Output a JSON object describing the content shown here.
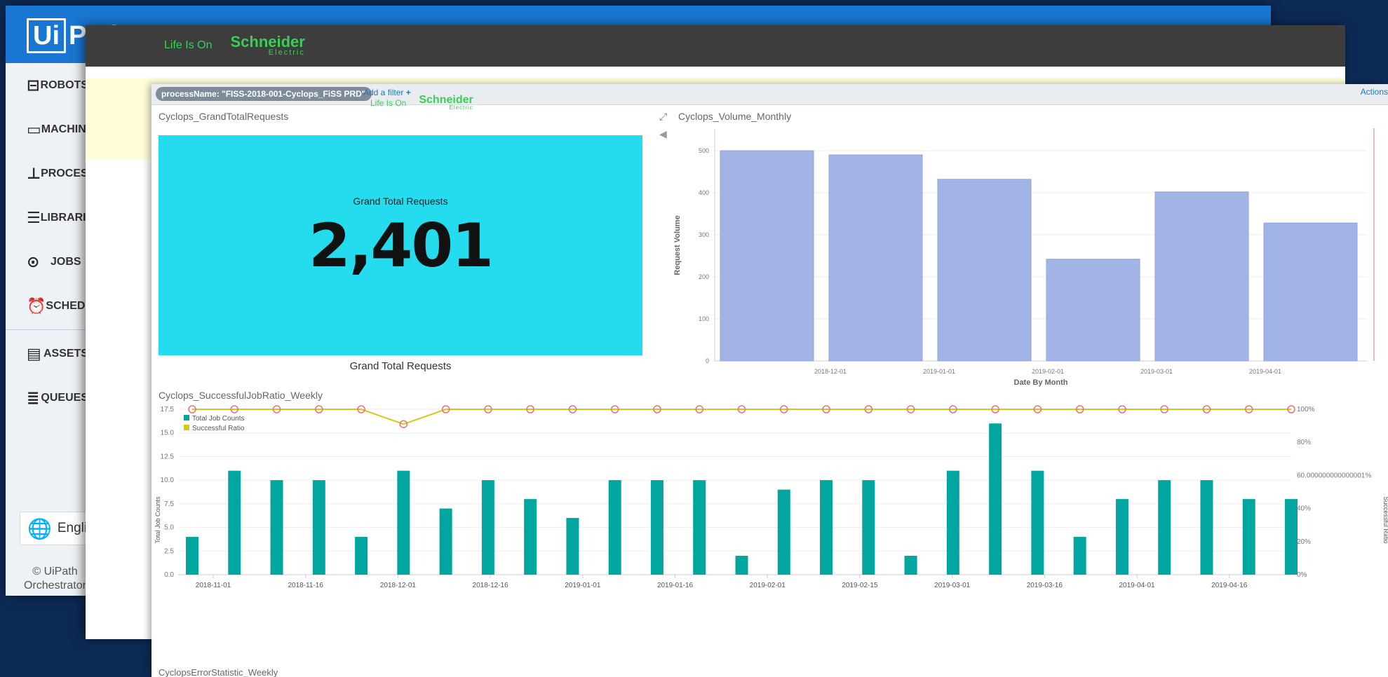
{
  "orchestrator": {
    "logo_box": "Ui",
    "logo_rest": "Path",
    "nav": [
      {
        "label": "ROBOTS",
        "icon": "robot-icon"
      },
      {
        "label": "MACHINES",
        "icon": "monitor-icon"
      },
      {
        "label": "PROCESSES",
        "icon": "sitemap-icon"
      },
      {
        "label": "LIBRARIES",
        "icon": "library-icon"
      },
      {
        "label": "JOBS",
        "icon": "play-circle-icon"
      },
      {
        "label": "SCHEDULES",
        "icon": "alarm-clock-icon"
      },
      {
        "label": "ASSETS",
        "icon": "assets-icon"
      },
      {
        "label": "QUEUES",
        "icon": "queue-icon"
      }
    ],
    "language": "English",
    "copyright_line1": "© UiPath",
    "copyright_line2": "Orchestrator"
  },
  "portal": {
    "tagline": "Life Is On",
    "brand": "Schneider",
    "brand_sub": "Electric"
  },
  "kibana": {
    "filter_pill": "processName: \"FISS-2018-001-Cyclops_FiSS PRD\"",
    "add_filter": "Add a filter",
    "actions": "Actions",
    "tagline": "Life Is On",
    "brand": "Schneider",
    "brand_sub": "Electric",
    "panels": {
      "grand_total": {
        "title": "Cyclops_GrandTotalRequests",
        "label": "Grand Total Requests",
        "value": "2,401",
        "caption": "Grand Total Requests",
        "color": "#24dcee"
      },
      "volume_monthly_title": "Cyclops_Volume_Monthly",
      "job_ratio_title": "Cyclops_SuccessfulJobRatio_Weekly",
      "error_stat_title": "CyclopsErrorStatistic_Weekly"
    }
  },
  "chart_data": [
    {
      "type": "bar",
      "title": "Cyclops_Volume_Monthly",
      "xlabel": "Date By Month",
      "ylabel": "Request Volume",
      "x_tick_labels": [
        "2018-12-01",
        "2019-01-01",
        "2019-02-01",
        "2019-03-01",
        "2019-04-01"
      ],
      "values": [
        500,
        490,
        432,
        242,
        402,
        328
      ],
      "yticks": [
        0,
        100,
        200,
        300,
        400,
        500
      ],
      "ylim": [
        0,
        550
      ],
      "bar_color": "#a2b4e6",
      "grid": true
    },
    {
      "type": "bar+line",
      "title": "Cyclops_SuccessfulJobRatio_Weekly",
      "ylabel": "Total Job Counts",
      "y2label": "Successful Ratio",
      "legend": [
        "Total Job Counts",
        "Successful Ratio"
      ],
      "legend_position": "top-left",
      "x_tick_labels": [
        "2018-11-01",
        "2018-11-16",
        "2018-12-01",
        "2018-12-16",
        "2019-01-01",
        "2019-01-16",
        "2019-02-01",
        "2019-02-15",
        "2019-03-01",
        "2019-03-16",
        "2019-04-01",
        "2019-04-16"
      ],
      "yticks": [
        "0.0",
        "2.5",
        "5.0",
        "7.5",
        "10.0",
        "12.5",
        "15.0",
        "17.5"
      ],
      "ylim": [
        0,
        17.5
      ],
      "y2ticks": [
        "0%",
        "20%",
        "40%",
        "60.000000000000001%",
        "80%",
        "100%"
      ],
      "series": [
        {
          "name": "Total Job Counts",
          "color": "#00a69f",
          "values": [
            4,
            11,
            10,
            10,
            4,
            11,
            7,
            10,
            8,
            6,
            10,
            10,
            10,
            2,
            9,
            10,
            10,
            2,
            11,
            16,
            11,
            4,
            8,
            10,
            10,
            8,
            8
          ]
        },
        {
          "name": "Successful Ratio",
          "color": "#d4c81c",
          "values": [
            100,
            100,
            100,
            100,
            100,
            91,
            100,
            100,
            100,
            100,
            100,
            100,
            100,
            100,
            100,
            100,
            100,
            100,
            100,
            100,
            100,
            100,
            100,
            100,
            100,
            100,
            100
          ]
        }
      ],
      "grid": true
    }
  ]
}
